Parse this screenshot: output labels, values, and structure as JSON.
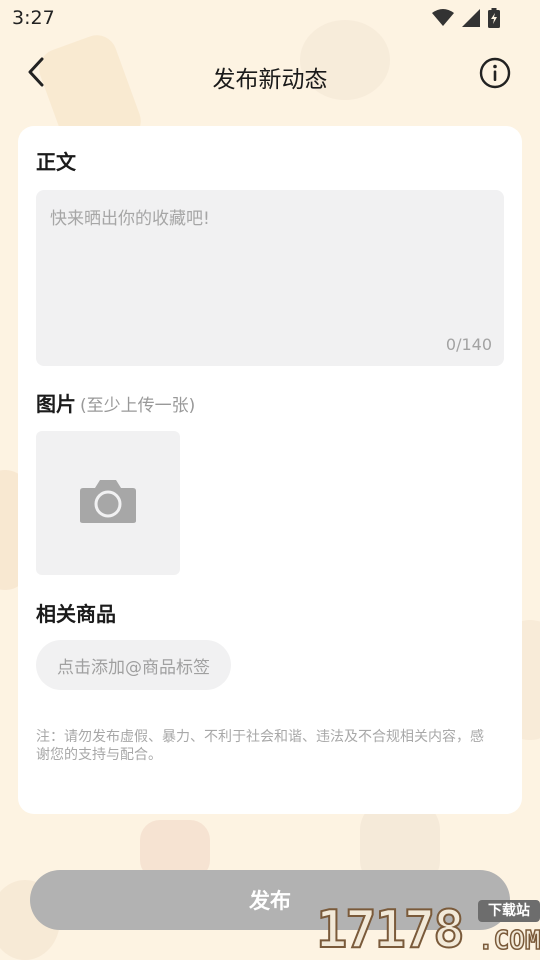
{
  "status_bar": {
    "time": "3:27",
    "icons": [
      "wifi-icon",
      "cellular-signal-icon",
      "battery-charging-icon"
    ]
  },
  "nav": {
    "title": "发布新动态",
    "back_icon": "chevron-left-icon",
    "info_icon": "info-circle-icon"
  },
  "form": {
    "body_section": {
      "title": "正文",
      "placeholder": "快来晒出你的收藏吧!",
      "value": "",
      "char_count": "0/140"
    },
    "photo_section": {
      "title": "图片",
      "hint": "(至少上传一张)",
      "upload_icon": "camera-icon"
    },
    "goods_section": {
      "title": "相关商品",
      "tag_button": "点击添加@商品标签"
    },
    "notice": "注：请勿发布虚假、暴力、不利于社会和谐、违法及不合规相关内容，感谢您的支持与配合。"
  },
  "publish_button": "发布",
  "watermark": {
    "number": "17178",
    "tag": "下载站",
    "domain": ".COM"
  },
  "colors": {
    "background": "#fdf3e2",
    "card": "#ffffff",
    "input_bg": "#f1f1f2",
    "publish_disabled": "#b2b2b2",
    "placeholder_text": "#a6a6a6"
  }
}
